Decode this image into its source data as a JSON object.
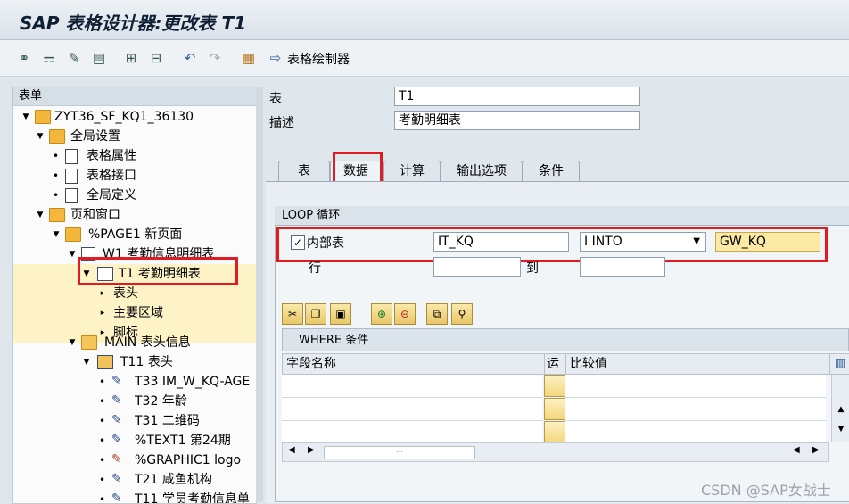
{
  "window": {
    "title": "SAP 表格设计器:更改表 T1"
  },
  "toolbar": {
    "form_painter_label": "表格绘制器",
    "icons": [
      "glasses-icon",
      "hierarchy-icon",
      "magic-wand-icon",
      "print-preview-icon",
      "expand-icon",
      "collapse-icon",
      "undo-icon",
      "redo-icon",
      "layout-icon",
      "arrow-right-icon"
    ]
  },
  "tree": {
    "header": "表单",
    "items": [
      {
        "label": "ZYT36_SF_KQ1_36130",
        "icon": "folder-icon"
      },
      {
        "label": "全局设置",
        "icon": "folder-icon"
      },
      {
        "label": "表格属性",
        "icon": "document-icon"
      },
      {
        "label": "表格接口",
        "icon": "document-icon"
      },
      {
        "label": "全局定义",
        "icon": "document-icon"
      },
      {
        "label": "页和窗口",
        "icon": "folder-icon"
      },
      {
        "label": "%PAGE1 新页面",
        "icon": "folder-icon"
      },
      {
        "label": "W1 考勤信息明细表",
        "icon": "window-icon"
      },
      {
        "label": "T1 考勤明细表",
        "icon": "table-icon"
      },
      {
        "label": "表头",
        "icon": ""
      },
      {
        "label": "主要区域",
        "icon": ""
      },
      {
        "label": "脚标",
        "icon": ""
      },
      {
        "label": "MAIN 表头信息",
        "icon": "window-icon"
      },
      {
        "label": "T11 表头",
        "icon": "table-grid-icon"
      },
      {
        "label": "T33 IM_W_KQ-AGE",
        "icon": "text-edit-icon"
      },
      {
        "label": "T32 年龄",
        "icon": "text-edit-icon"
      },
      {
        "label": "T31 二维码",
        "icon": "text-edit-icon"
      },
      {
        "label": "%TEXT1 第24期",
        "icon": "text-edit-icon"
      },
      {
        "label": "%GRAPHIC1 logo",
        "icon": "graphic-icon"
      },
      {
        "label": "T21 咸鱼机构",
        "icon": "text-edit-icon"
      },
      {
        "label": "T11 学员考勤信息单",
        "icon": "text-edit-icon"
      }
    ]
  },
  "form": {
    "table_label": "表",
    "table_value": "T1",
    "desc_label": "描述",
    "desc_value": "考勤明细表"
  },
  "tabs": [
    "表",
    "数据",
    "计算",
    "输出选项",
    "条件"
  ],
  "loop": {
    "header": "LOOP 循环",
    "internal_table_label": "内部表",
    "internal_table_checked": true,
    "internal_table_value": "IT_KQ",
    "into_mode": "I INTO",
    "work_area": "GW_KQ",
    "row_label": "行",
    "to_label": "到",
    "row_from": "",
    "row_to": ""
  },
  "where": {
    "header": "WHERE 条件",
    "columns": [
      "字段名称",
      "运",
      "比较值"
    ]
  },
  "watermark": "CSDN @SAP女战士"
}
